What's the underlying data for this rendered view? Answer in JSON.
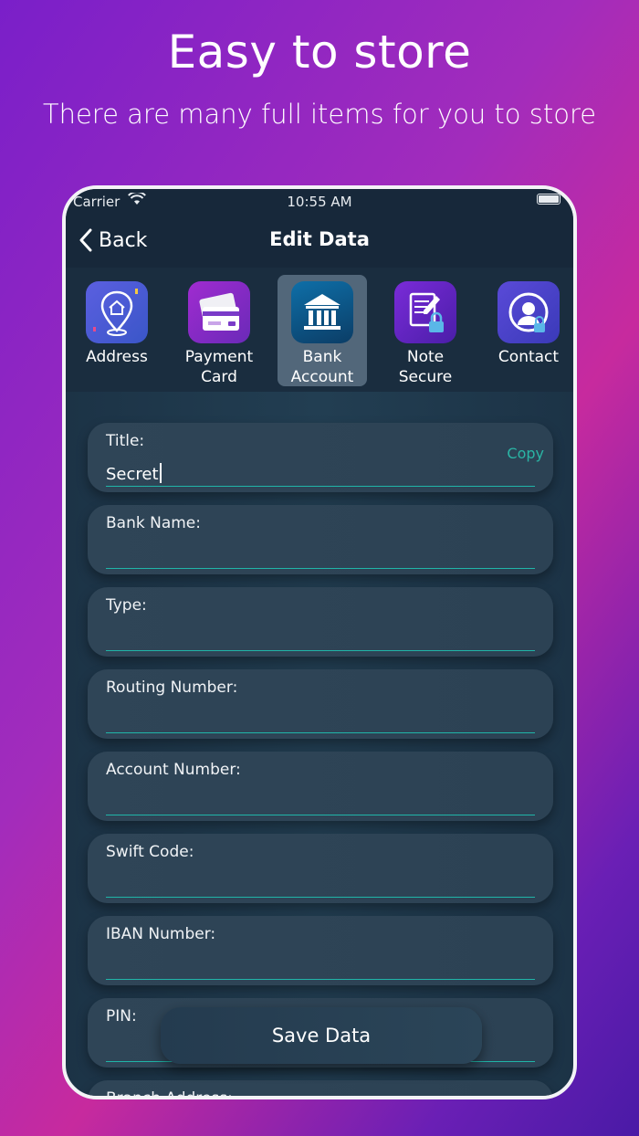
{
  "promo": {
    "title": "Easy to store",
    "subtitle": "There are many full items for you to store"
  },
  "statusbar": {
    "carrier": "Carrier",
    "time": "10:55 AM"
  },
  "navbar": {
    "back_label": "Back",
    "title": "Edit Data"
  },
  "categories": [
    {
      "line1": "Address",
      "line2": "",
      "icon": "map-pin-home-icon"
    },
    {
      "line1": "Payment",
      "line2": "Card",
      "icon": "credit-card-icon"
    },
    {
      "line1": "Bank",
      "line2": "Account",
      "icon": "bank-building-icon"
    },
    {
      "line1": "Note",
      "line2": "Secure",
      "icon": "secure-note-icon"
    },
    {
      "line1": "Contact",
      "line2": "",
      "icon": "contact-person-icon"
    }
  ],
  "fields": [
    {
      "label": "Title:",
      "value": "Secret"
    },
    {
      "label": "Bank Name:",
      "value": ""
    },
    {
      "label": "Type:",
      "value": ""
    },
    {
      "label": "Routing Number:",
      "value": ""
    },
    {
      "label": "Account Number:",
      "value": ""
    },
    {
      "label": "Swift Code:",
      "value": ""
    },
    {
      "label": "IBAN Number:",
      "value": ""
    },
    {
      "label": "PIN:",
      "value": ""
    },
    {
      "label": "Branch Address:",
      "value": ""
    }
  ],
  "copy_label": "Copy",
  "save_label": "Save Data",
  "colors": {
    "accent": "#2ab5a5",
    "panel": "#2f4557",
    "nav": "#17283a"
  }
}
